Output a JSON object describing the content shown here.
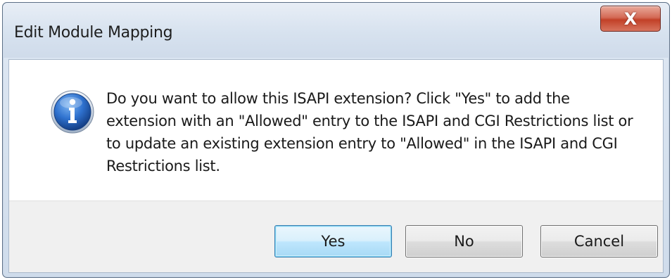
{
  "window": {
    "title": "Edit Module Mapping",
    "close_glyph": "X"
  },
  "dialog": {
    "icon": "information-icon",
    "message": "Do you want to allow this ISAPI extension? Click \"Yes\" to add the extension with an \"Allowed\" entry to the ISAPI and CGI Restrictions list or to update an existing extension entry to \"Allowed\" in the ISAPI and CGI Restrictions list."
  },
  "buttons": {
    "yes_label": "Yes",
    "no_label": "No",
    "cancel_label": "Cancel",
    "default": "yes"
  },
  "colors": {
    "close_button": "#c24128",
    "info_icon": "#1f5fb5",
    "default_button_border": "#3c7fb1"
  }
}
